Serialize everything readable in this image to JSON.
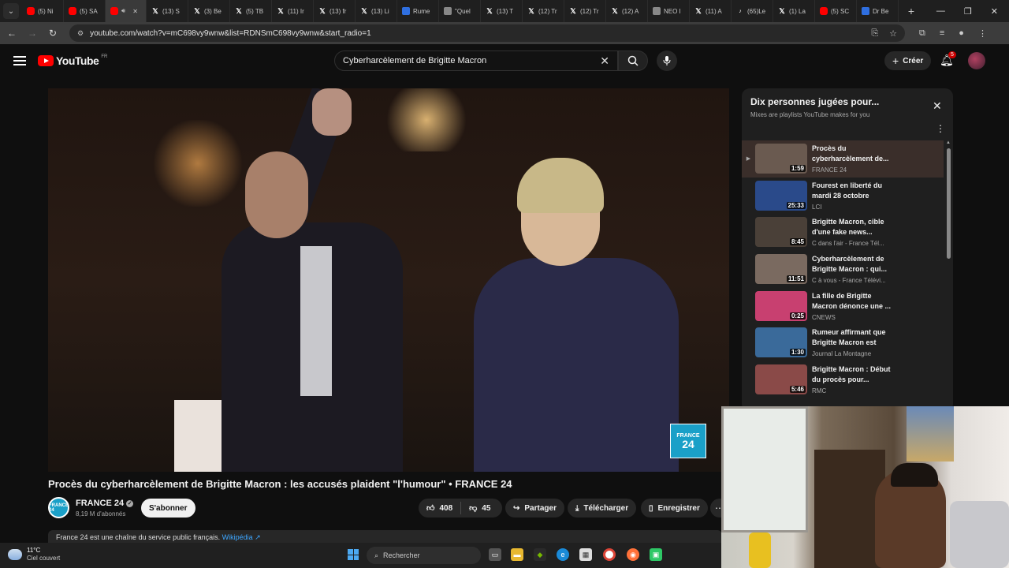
{
  "browser": {
    "tabs": [
      {
        "label": "(5) Ni",
        "fav": "yt"
      },
      {
        "label": "(5) SA",
        "fav": "yt"
      },
      {
        "label": "",
        "fav": "yt",
        "active": true
      },
      {
        "label": "(13) S",
        "fav": "x"
      },
      {
        "label": "(3) Be",
        "fav": "x"
      },
      {
        "label": "(5) TB",
        "fav": "x"
      },
      {
        "label": "(11) Ir",
        "fav": "x"
      },
      {
        "label": "(13) fr",
        "fav": "x"
      },
      {
        "label": "(13) Li",
        "fav": "x"
      },
      {
        "label": "Rume",
        "fav": "blue"
      },
      {
        "label": "\"Quel",
        "fav": "gray"
      },
      {
        "label": "(13) T",
        "fav": "x"
      },
      {
        "label": "(12) Tr",
        "fav": "x"
      },
      {
        "label": "(12) Tr",
        "fav": "x"
      },
      {
        "label": "(12) A",
        "fav": "x"
      },
      {
        "label": "NEO I",
        "fav": "gray"
      },
      {
        "label": "(11) A",
        "fav": "x"
      },
      {
        "label": "(65)Le",
        "fav": "tiktok"
      },
      {
        "label": "(1) La",
        "fav": "x"
      },
      {
        "label": "(5) SC",
        "fav": "yt"
      },
      {
        "label": "Dr Be",
        "fav": "blue"
      }
    ],
    "url": "youtube.com/watch?v=mC698vy9wnw&list=RDNSmC698vy9wnw&start_radio=1"
  },
  "youtube": {
    "logo_text": "YouTube",
    "region": "FR",
    "search_value": "Cyberharcèlement de Brigitte Macron",
    "create_label": "Créer",
    "notifications_count": "5"
  },
  "video": {
    "title": "Procès du cyberharcèlement de Brigitte Macron : les accusés plaident \"l'humour\" • FRANCE 24",
    "watermark_line1": "FRANCE",
    "watermark_line2": "24",
    "channel_name": "FRANCE 24",
    "channel_avatar": "FRANCE 24",
    "subscribers": "8,19 M d'abonnés",
    "subscribe_label": "S'abonner",
    "likes": "408",
    "dislikes": "45",
    "share_label": "Partager",
    "download_label": "Télécharger",
    "save_label": "Enregistrer",
    "description_text": "France 24 est une chaîne du service public français.",
    "description_link": "Wikipédia ↗"
  },
  "playlist": {
    "title": "Dix personnes jugées pour...",
    "subtitle": "Mixes are playlists YouTube makes for you",
    "items": [
      {
        "title": "Procès du cyberharcèlement de...",
        "channel": "FRANCE 24",
        "duration": "1:59",
        "current": true,
        "thumb": "#6a5a50"
      },
      {
        "title": "Fourest en liberté du mardi 28 octobre",
        "channel": "LCI",
        "duration": "25:33",
        "current": false,
        "thumb": "#2a4a8a"
      },
      {
        "title": "Brigitte Macron, cible d'une fake news...",
        "channel": "C dans l'air - France Tél...",
        "duration": "8:45",
        "current": false,
        "thumb": "#4a4038"
      },
      {
        "title": "Cyberharcèlement de Brigitte Macron : qui...",
        "channel": "C à vous - France Télévi...",
        "duration": "11:51",
        "current": false,
        "thumb": "#7a6a60"
      },
      {
        "title": "La fille de Brigitte Macron dénonce une ...",
        "channel": "CNEWS",
        "duration": "0:25",
        "current": false,
        "thumb": "#c84070"
      },
      {
        "title": "Rumeur affirmant que Brigitte Macron est un...",
        "channel": "Journal La Montagne",
        "duration": "1:30",
        "current": false,
        "thumb": "#3a6a9a"
      },
      {
        "title": "Brigitte Macron : Début du procès pour...",
        "channel": "RMC",
        "duration": "5:46",
        "current": false,
        "thumb": "#8a4a48"
      }
    ]
  },
  "taskbar": {
    "temperature": "11°C",
    "weather": "Ciel couvert",
    "search_placeholder": "Rechercher"
  }
}
